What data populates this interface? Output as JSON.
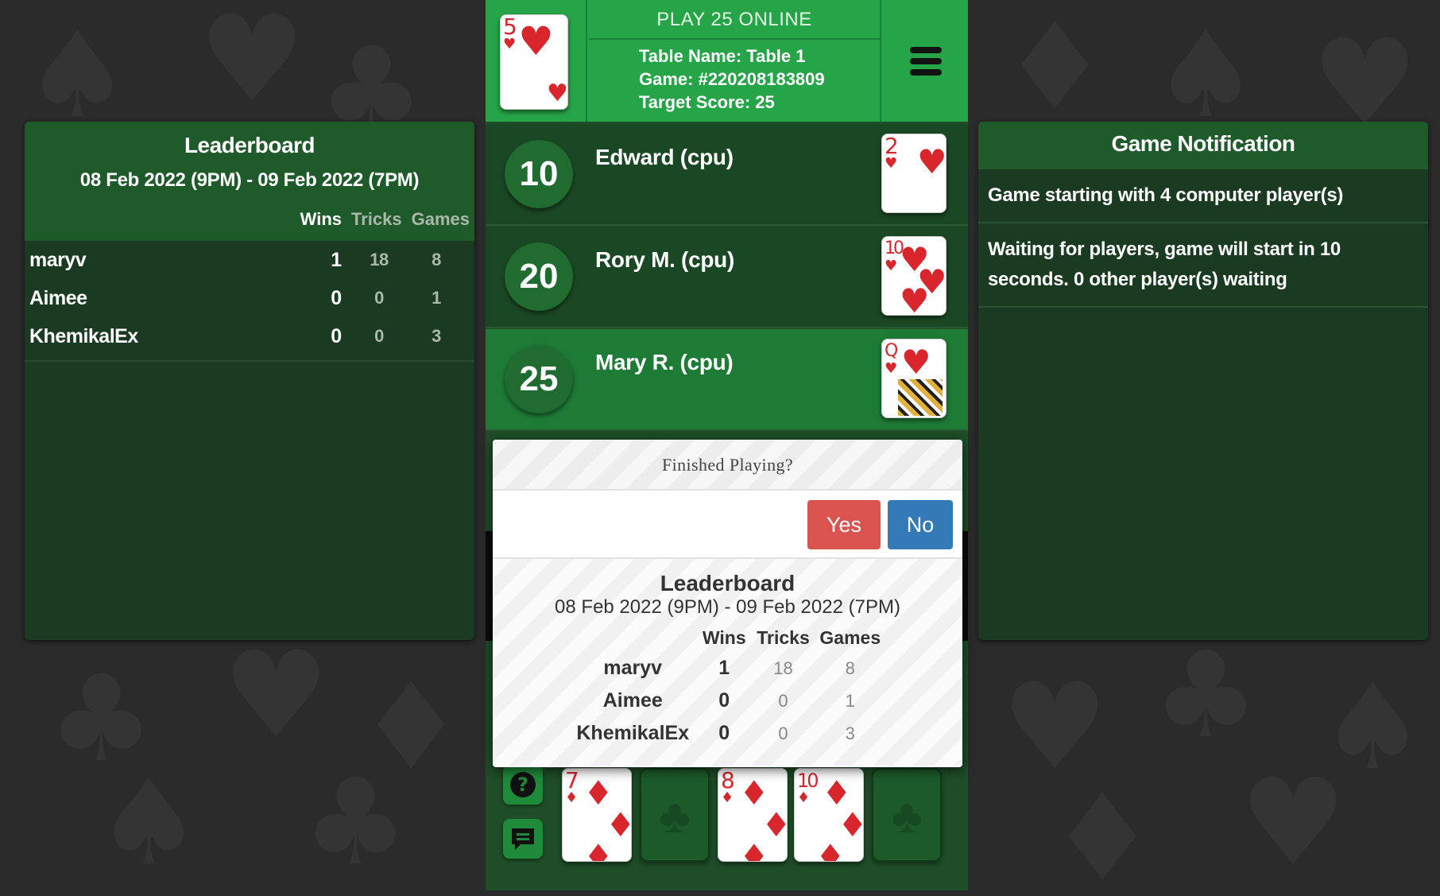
{
  "header": {
    "site_title": "PLAY 25 ONLINE",
    "table_name": "Table Name: Table 1",
    "game_id": "Game: #220208183809",
    "target_score": "Target Score: 25",
    "top_card": {
      "rank": "5",
      "suit": "♥"
    }
  },
  "leaderboard": {
    "title": "Leaderboard",
    "date_range": "08 Feb 2022 (9PM) - 09 Feb 2022 (7PM)",
    "columns": {
      "wins": "Wins",
      "tricks": "Tricks",
      "games": "Games"
    },
    "rows": [
      {
        "name": "maryv",
        "wins": "1",
        "tricks": "18",
        "games": "8"
      },
      {
        "name": "Aimee",
        "wins": "0",
        "tricks": "0",
        "games": "1"
      },
      {
        "name": "KhemikalEx",
        "wins": "0",
        "tricks": "0",
        "games": "3"
      }
    ]
  },
  "notifications": {
    "title": "Game Notification",
    "items": [
      "Game starting with 4 computer player(s)",
      "Waiting for players, game will start in 10 seconds. 0 other player(s) waiting"
    ]
  },
  "players": [
    {
      "score": "10",
      "name": "Edward (cpu)",
      "card_rank": "2",
      "card_suit": "♥"
    },
    {
      "score": "20",
      "name": "Rory M. (cpu)",
      "card_rank": "10",
      "card_suit": "♥"
    },
    {
      "score": "25",
      "name": "Mary R. (cpu)",
      "card_rank": "Q",
      "card_suit": "♥"
    }
  ],
  "dialog": {
    "title": "Finished Playing?",
    "yes_label": "Yes",
    "no_label": "No"
  },
  "hand": [
    {
      "rank": "7",
      "suit": "♦"
    },
    {
      "rank": "8",
      "suit": "♦"
    },
    {
      "rank": "10",
      "suit": "♦"
    }
  ],
  "icons": {
    "help": "question-circle-icon",
    "chat": "chat-bubble-icon",
    "menu": "hamburger-menu-icon"
  },
  "colors": {
    "table_green": "#26a448",
    "panel_green": "#1a3b22",
    "active_row": "#1d7b36",
    "yes_button": "#d9534f",
    "no_button": "#337ab7",
    "card_red": "#d9262c"
  }
}
